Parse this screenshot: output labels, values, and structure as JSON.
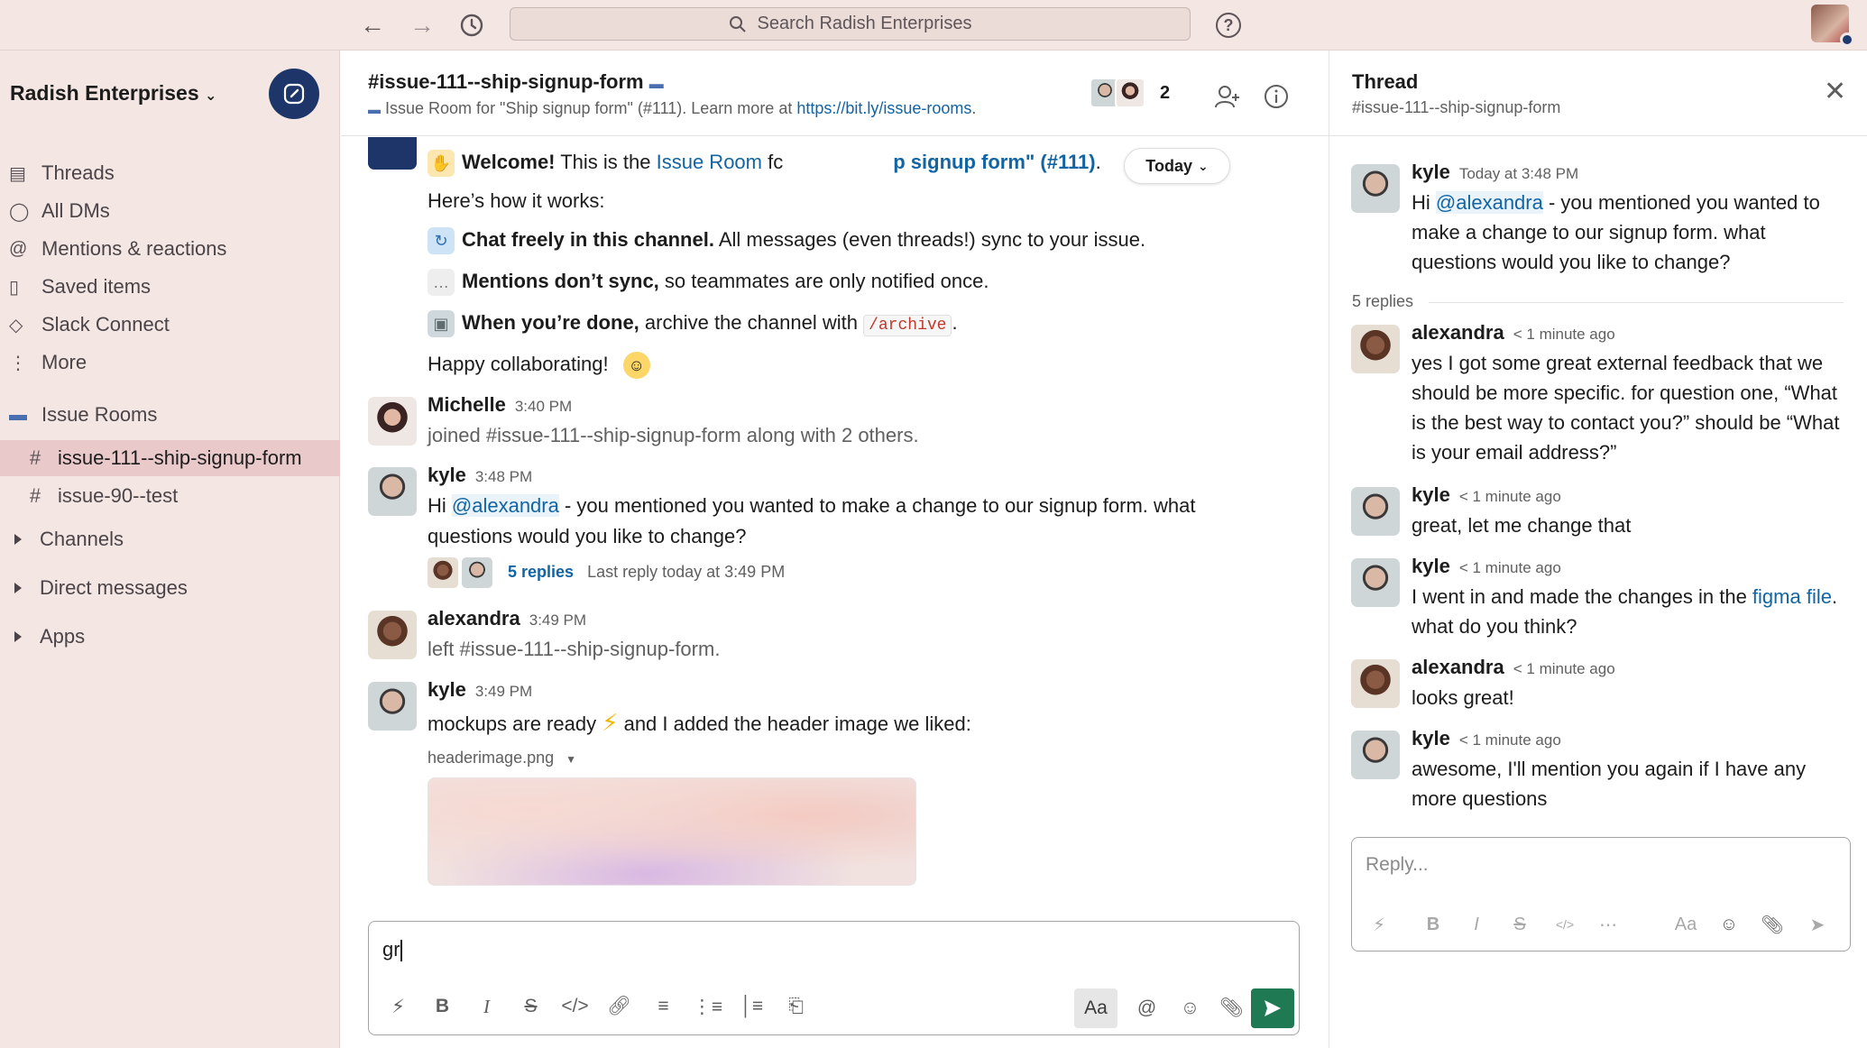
{
  "search": {
    "label": "Search Radish Enterprises"
  },
  "workspace": {
    "name": "Radish Enterprises"
  },
  "sidebar": {
    "items": [
      {
        "label": "Threads"
      },
      {
        "label": "All DMs"
      },
      {
        "label": "Mentions & reactions"
      },
      {
        "label": "Saved items"
      },
      {
        "label": "Slack Connect"
      },
      {
        "label": "More"
      }
    ],
    "section": {
      "label": "Issue Rooms"
    },
    "channels": [
      {
        "label": "issue-111--ship-signup-form"
      },
      {
        "label": "issue-90--test"
      }
    ],
    "groups": [
      {
        "label": "Channels"
      },
      {
        "label": "Direct messages"
      },
      {
        "label": "Apps"
      }
    ]
  },
  "channel": {
    "title": "#issue-111--ship-signup-form",
    "topic_prefix": "Issue Room for \"Ship signup form\" (#111). Learn more at ",
    "topic_link": "https://bit.ly/issue-rooms",
    "topic_suffix": ".",
    "member_count": "2"
  },
  "messages": {
    "today_label": "Today",
    "welcome": {
      "bold": "Welcome!",
      "text": " This is the ",
      "link1": "Issue Room",
      "text2": " fc",
      "link2": "p signup form\" (#111)",
      "end": "."
    },
    "how_it_works": "Here’s how it works:",
    "tips": [
      {
        "bold": "Chat freely in this channel.",
        "text": " All messages (even threads!) sync to your issue."
      },
      {
        "bold": "Mentions don’t sync,",
        "text": " so teammates are only notified once."
      },
      {
        "bold": "When you’re done,",
        "text": " archive the channel with ",
        "code": "/archive",
        "end": "."
      }
    ],
    "happy": "Happy collaborating!",
    "michelle": {
      "name": "Michelle",
      "time": "3:40 PM",
      "text": "joined #issue-111--ship-signup-form along with 2 others."
    },
    "kyle1": {
      "name": "kyle",
      "time": "3:48 PM",
      "pre": "Hi ",
      "mention": "@alexandra",
      "text1": " - you mentioned you wanted to make a change to our signup form. what",
      "text2": "questions would you like to change?",
      "replies": "5 replies",
      "last_reply": "Last reply today at 3:49 PM"
    },
    "alexandra": {
      "name": "alexandra",
      "time": "3:49 PM",
      "text": "left #issue-111--ship-signup-form."
    },
    "kyle2": {
      "name": "kyle",
      "time": "3:49 PM",
      "text_a": "mockups are ready ",
      "text_b": " and I added the header image we liked:",
      "file": "headerimage.png"
    }
  },
  "composer": {
    "draft": "gr",
    "aa": "Aa"
  },
  "thread": {
    "title": "Thread",
    "channel": "#issue-111--ship-signup-form",
    "parent": {
      "name": "kyle",
      "time": "Today at 3:48 PM",
      "pre": "Hi ",
      "mention": "@alexandra",
      "line1": " - you mentioned you wanted to",
      "line2": "make a change to our signup form. what",
      "line3": "questions would you like to change?"
    },
    "replies_label": "5 replies",
    "replies": [
      {
        "name": "alexandra",
        "time": "< 1 minute ago",
        "lines": [
          "yes I got some great external feedback that we",
          "should be more specific. for question one, “What",
          "is the best way to contact you?” should be “What",
          "is your email address?”"
        ]
      },
      {
        "name": "kyle",
        "time": "< 1 minute ago",
        "lines": [
          "great, let me change that"
        ]
      },
      {
        "name": "kyle",
        "time": "< 1 minute ago",
        "pre": "I went in and made the changes in the ",
        "link": "figma file",
        "post": ".",
        "line2": "what do you think?"
      },
      {
        "name": "alexandra",
        "time": "< 1 minute ago",
        "lines": [
          "looks great!"
        ]
      },
      {
        "name": "kyle",
        "time": "< 1 minute ago",
        "lines": [
          "awesome, I'll mention you again if I have any",
          "more questions"
        ]
      }
    ],
    "reply_placeholder": "Reply...",
    "aa": "Aa"
  }
}
